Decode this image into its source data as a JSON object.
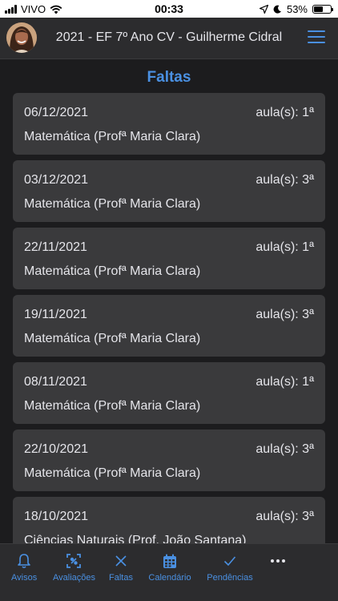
{
  "status_bar": {
    "carrier": "VIVO",
    "time": "00:33",
    "battery": "53%",
    "battery_level": 0.53
  },
  "header": {
    "title": "2021 - EF 7º Ano CV - Guilherme Cidral",
    "menu_icon": "hamburger-menu-icon"
  },
  "page": {
    "title": "Faltas"
  },
  "absences": [
    {
      "date": "06/12/2021",
      "aula": "aula(s): 1ª",
      "subject": "Matemática (Profª Maria Clara)"
    },
    {
      "date": "03/12/2021",
      "aula": "aula(s): 3ª",
      "subject": "Matemática (Profª Maria Clara)"
    },
    {
      "date": "22/11/2021",
      "aula": "aula(s): 1ª",
      "subject": "Matemática (Profª Maria Clara)"
    },
    {
      "date": "19/11/2021",
      "aula": "aula(s): 3ª",
      "subject": "Matemática (Profª Maria Clara)"
    },
    {
      "date": "08/11/2021",
      "aula": "aula(s): 1ª",
      "subject": "Matemática (Profª Maria Clara)"
    },
    {
      "date": "22/10/2021",
      "aula": "aula(s): 3ª",
      "subject": "Matemática (Profª Maria Clara)"
    },
    {
      "date": "18/10/2021",
      "aula": "aula(s): 3ª",
      "subject": "Ciências Naturais (Prof. João Santana)"
    }
  ],
  "tabs": [
    {
      "label": "Avisos",
      "icon": "bell-icon"
    },
    {
      "label": "Avaliações",
      "icon": "evaluation-icon"
    },
    {
      "label": "Faltas",
      "icon": "close-icon"
    },
    {
      "label": "Calendário",
      "icon": "calendar-icon"
    },
    {
      "label": "Pendências",
      "icon": "checkmark-icon"
    },
    {
      "label": "",
      "icon": "more-icon"
    }
  ],
  "colors": {
    "accent": "#4a90e2",
    "background": "#1c1c1e",
    "card": "#3a3a3c",
    "header": "#2c2c2e"
  }
}
